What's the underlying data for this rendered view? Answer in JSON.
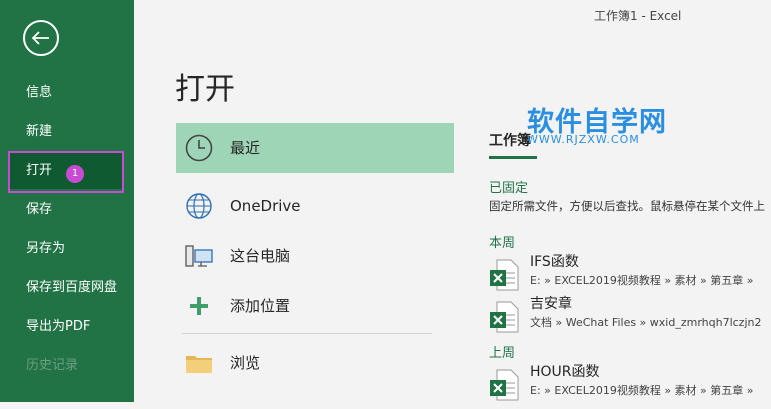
{
  "window": {
    "title": "工作簿1  -  Excel"
  },
  "sidebar": {
    "items": [
      {
        "label": "信息"
      },
      {
        "label": "新建"
      },
      {
        "label": "打开"
      },
      {
        "label": "保存"
      },
      {
        "label": "另存为"
      },
      {
        "label": "保存到百度网盘"
      },
      {
        "label": "导出为PDF"
      },
      {
        "label": "历史记录"
      }
    ],
    "step_badge": "1"
  },
  "main": {
    "title": "打开",
    "places": [
      {
        "label": "最近",
        "icon": "clock-icon"
      },
      {
        "label": "OneDrive",
        "icon": "globe-icon"
      },
      {
        "label": "这台电脑",
        "icon": "computer-icon"
      },
      {
        "label": "添加位置",
        "icon": "plus-icon"
      },
      {
        "label": "浏览",
        "icon": "folder-icon"
      }
    ]
  },
  "recent": {
    "tab": "工作簿",
    "watermark": {
      "title": "软件自学网",
      "url": "WWW.RJZXW.COM"
    },
    "pinned_title": "已固定",
    "pinned_desc": "固定所需文件，方便以后查找。鼠标悬停在某个文件上",
    "this_week": "本周",
    "last_week": "上周",
    "files": [
      {
        "name": "IFS函数",
        "path": "E: » EXCEL2019视频教程 » 素材 » 第五章 »"
      },
      {
        "name": "吉安章",
        "path": "文档 » WeChat Files » wxid_zmrhqh7lczjn2"
      },
      {
        "name": "HOUR函数",
        "path": "E: » EXCEL2019视频教程 » 素材 » 第五章 »"
      }
    ]
  },
  "colors": {
    "brand": "#217346",
    "selected": "#9fd5b7",
    "annotation": "#c74bd3",
    "watermark": "#2a8fe0"
  }
}
